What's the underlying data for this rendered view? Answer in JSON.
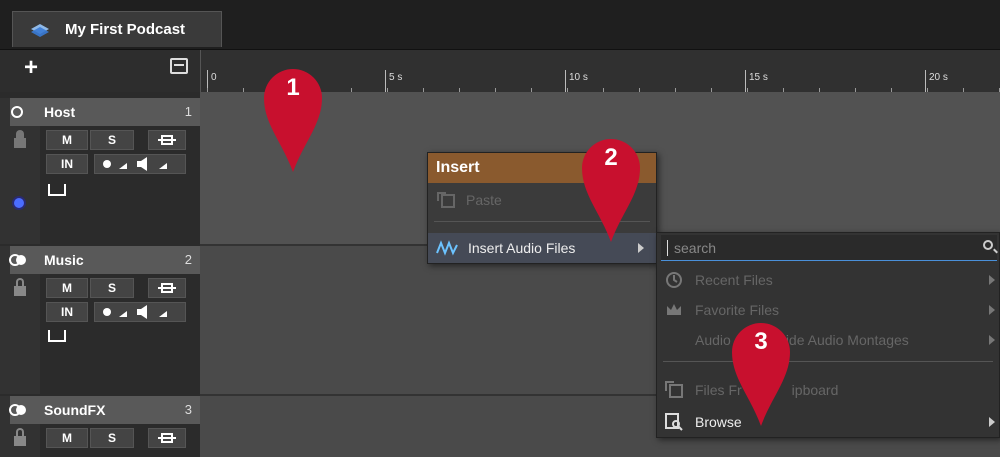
{
  "project_tab": {
    "title": "My First Podcast",
    "icon": "montage-icon"
  },
  "toolbar": {
    "add_icon": "plus-icon",
    "collapse_icon": "collapse-icon"
  },
  "ruler": {
    "labels": [
      "0",
      "5 s",
      "10 s",
      "15 s",
      "20 s"
    ]
  },
  "tracks": [
    {
      "name": "Host",
      "number": "1",
      "kind_icon": "mono-icon",
      "mute": "M",
      "solo": "S",
      "input": "IN"
    },
    {
      "name": "Music",
      "number": "2",
      "kind_icon": "stereo-icon",
      "mute": "M",
      "solo": "S",
      "input": "IN"
    },
    {
      "name": "SoundFX",
      "number": "3",
      "kind_icon": "stereo-icon",
      "mute": "M",
      "solo": "S"
    }
  ],
  "insert_menu": {
    "title": "Insert",
    "items": [
      {
        "label": "Paste",
        "icon": "paste-icon",
        "enabled": false
      },
      {
        "label": "Insert Audio Files",
        "icon": "waveform-icon",
        "enabled": true,
        "has_submenu": true
      }
    ]
  },
  "submenu": {
    "search_placeholder": "search",
    "items": [
      {
        "label": "Recent Files",
        "icon": "clock-icon",
        "enabled": false
      },
      {
        "label": "Favorite Files",
        "icon": "crown-icon",
        "enabled": false
      },
      {
        "label_start": "Audio",
        "label_end": "side Audio Montages",
        "enabled": false
      },
      {
        "label_start": "Files Fr",
        "label_end": "ipboard",
        "icon": "clipboard-icon",
        "enabled": false
      },
      {
        "label": "Browse",
        "icon": "browse-icon",
        "enabled": true
      }
    ]
  },
  "callouts": [
    "1",
    "2",
    "3"
  ],
  "colors": {
    "pin": "#c8102e",
    "menu_header": "#8a5a2e",
    "record_dot": "#4b6dff"
  }
}
